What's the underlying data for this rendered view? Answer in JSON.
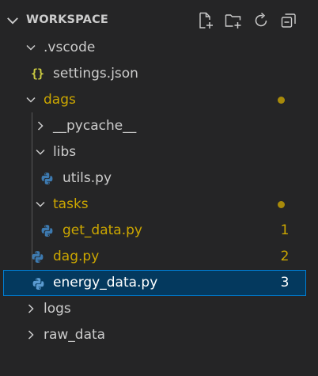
{
  "header": {
    "title": "WORKSPACE"
  },
  "colors": {
    "folder_modified": "#cca700",
    "file_default": "#cccccc",
    "selected_bg": "#04395e",
    "selected_border": "#007fd4",
    "python_blue": "#3d7ab0",
    "python_yellow": "#f6c744"
  },
  "tree": {
    "vscode": {
      "label": ".vscode",
      "icon": "chevron-down-icon"
    },
    "settings": {
      "label": "settings.json",
      "icon": "json-icon"
    },
    "dags": {
      "label": "dags",
      "icon": "chevron-down-icon",
      "modified": true
    },
    "pycache": {
      "label": "__pycache__",
      "icon": "chevron-right-icon"
    },
    "libs": {
      "label": "libs",
      "icon": "chevron-down-icon"
    },
    "utils": {
      "label": "utils.py",
      "icon": "python-icon"
    },
    "tasks": {
      "label": "tasks",
      "icon": "chevron-down-icon",
      "modified": true
    },
    "get_data": {
      "label": "get_data.py",
      "icon": "python-icon",
      "count": "1"
    },
    "dag": {
      "label": "dag.py",
      "icon": "python-icon",
      "count": "2"
    },
    "energy_data": {
      "label": "energy_data.py",
      "icon": "python-icon",
      "count": "3",
      "selected": true
    },
    "logs": {
      "label": "logs",
      "icon": "chevron-right-icon"
    },
    "raw_data": {
      "label": "raw_data",
      "icon": "chevron-right-icon"
    }
  }
}
